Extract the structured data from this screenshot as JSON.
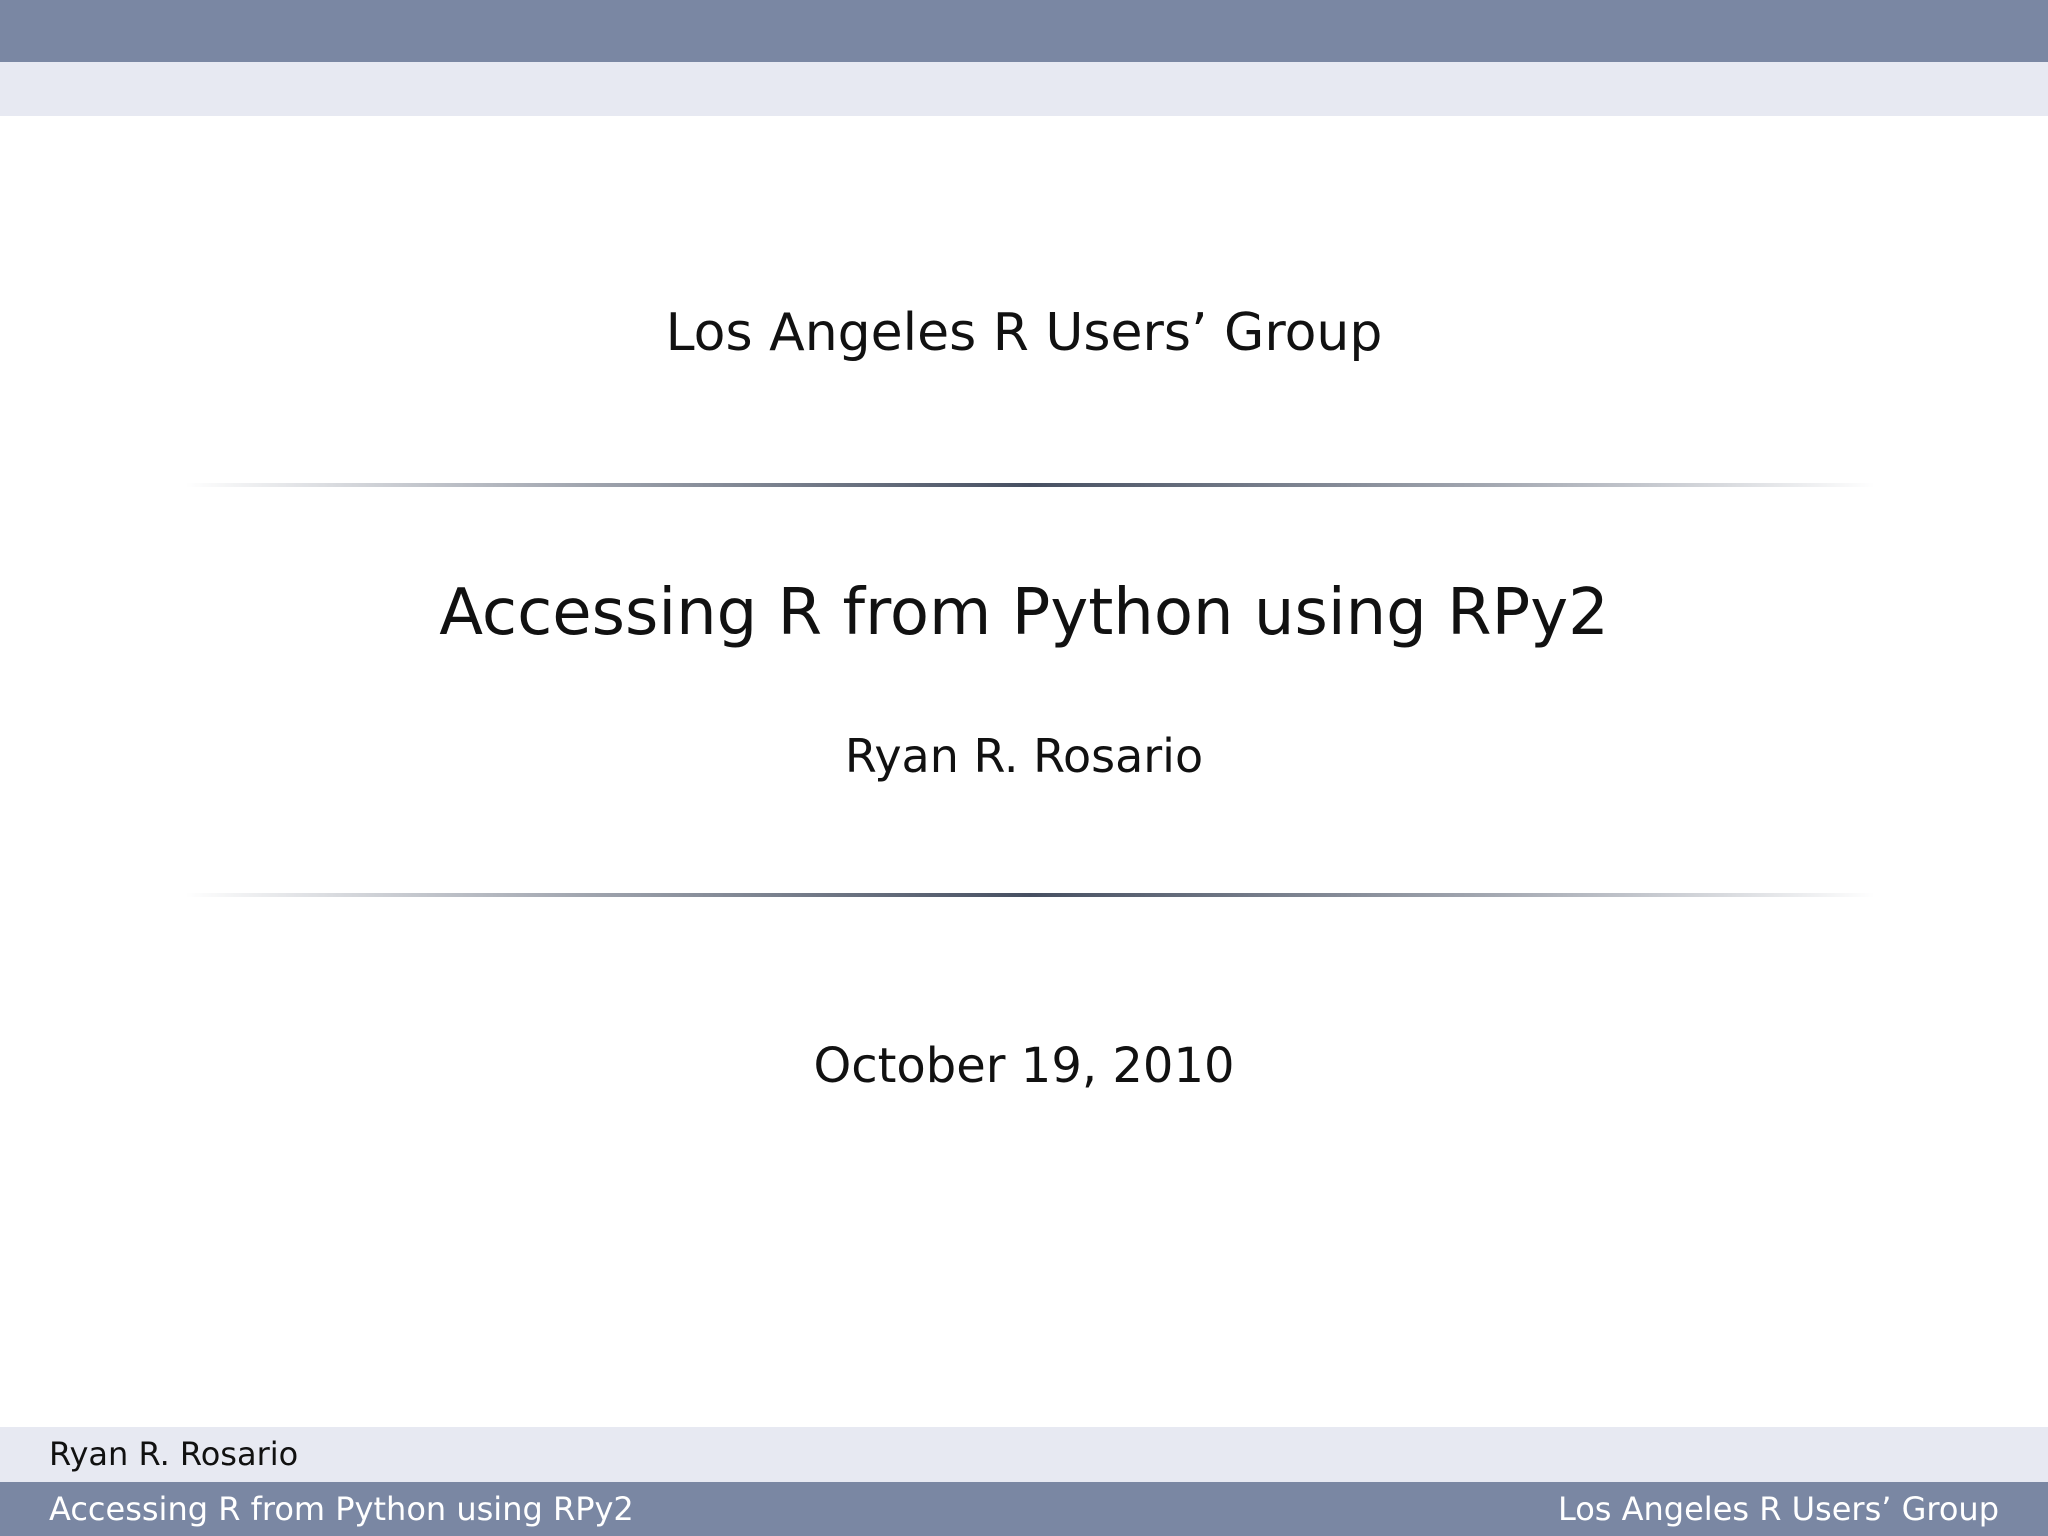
{
  "slide": {
    "institute": "Los Angeles R Users’ Group",
    "title": "Accessing R from Python using RPy2",
    "author": "Ryan R. Rosario",
    "date": "October 19, 2010"
  },
  "footer": {
    "author": "Ryan R. Rosario",
    "short_title": "Accessing R from Python using RPy2",
    "institute": "Los Angeles R Users’ Group"
  },
  "colors": {
    "header_bar": "#7a87a3",
    "header_light_bar": "#e7e9f2",
    "footer_bar": "#7a87a3",
    "footer_light_bar": "#e7e9f2"
  }
}
